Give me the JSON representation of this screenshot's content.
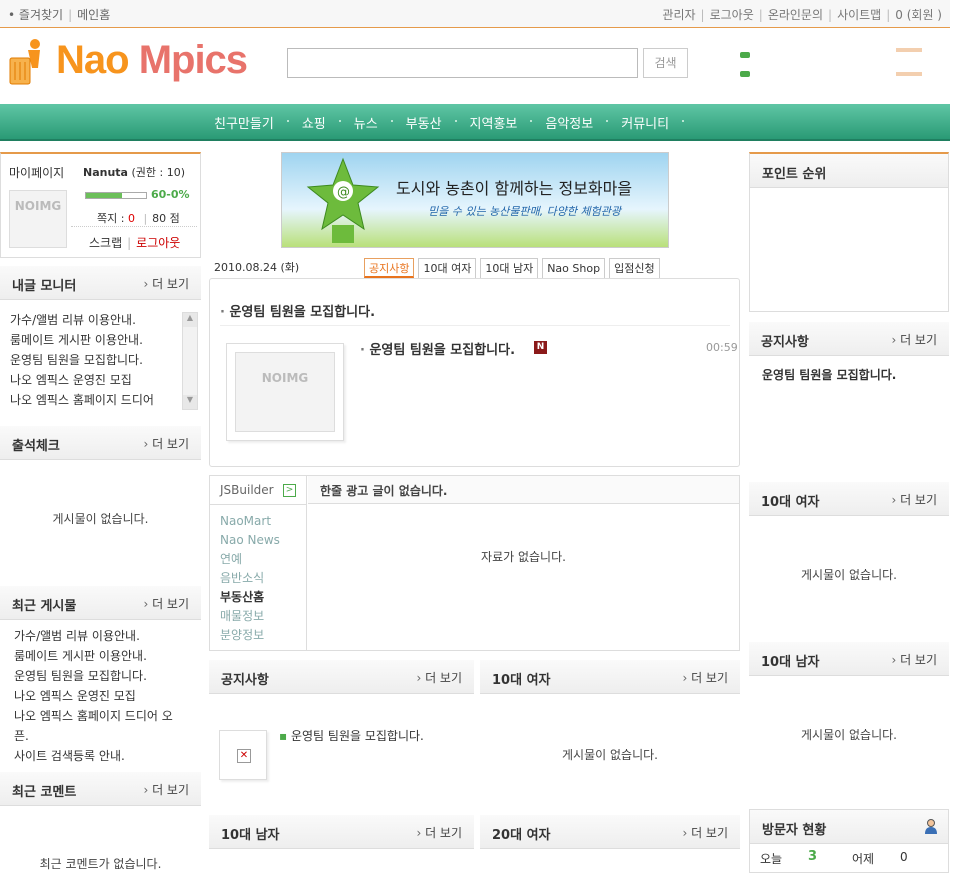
{
  "topbar": {
    "favorites": "즐겨찾기",
    "home": "메인홈",
    "admin": "관리자",
    "logout": "로그아웃",
    "inquiry": "온라인문의",
    "sitemap": "사이트맵",
    "members": "0 (회원 )"
  },
  "logo": {
    "part1": "Nao ",
    "part2": "Mpics"
  },
  "search": {
    "placeholder": "",
    "button": "검색"
  },
  "nav": [
    "친구만들기",
    "쇼핑",
    "뉴스",
    "부동산",
    "지역홍보",
    "음악정보",
    "커뮤니티"
  ],
  "mypage": {
    "title": "마이페이지",
    "user": "Nanuta",
    "level": "(권한 : 10)",
    "progress_label": "60-0%",
    "progress": 0.6,
    "note_label": "쪽지 :",
    "note_count": "0",
    "points": "80 점",
    "scrap": "스크랩",
    "logout": "로그아웃",
    "noimg": "NOIMG"
  },
  "left": {
    "monitor": {
      "title": "내글 모니터",
      "more": "더 보기",
      "items": [
        "가수/앨범 리뷰 이용안내.",
        "룸메이트 게시판 이용안내.",
        "운영팀 팀원을 모집합니다.",
        "나오 엠픽스 운영진 모집",
        "나오 엠픽스 홈페이지 드디어"
      ]
    },
    "attendance": {
      "title": "출석체크",
      "more": "더 보기",
      "empty": "게시물이 없습니다."
    },
    "recent": {
      "title": "최근 게시물",
      "more": "더 보기",
      "items": [
        "가수/앨범 리뷰 이용안내.",
        "룸메이트 게시판 이용안내.",
        "운영팀 팀원을 모집합니다.",
        "나오 엠픽스 운영진 모집",
        "나오 엠픽스 홈페이지 드디어 오",
        "픈.",
        "사이트 검색등록 안내."
      ]
    },
    "comments": {
      "title": "최근 코멘트",
      "more": "더 보기",
      "empty": "최근 코멘트가 없습니다."
    }
  },
  "banner": {
    "line1": "도시와 농촌이 함께하는 정보화마을",
    "line2": "믿을 수 있는 농산물판매, 다양한 체험관광"
  },
  "center": {
    "date": "2010.08.24 (화)",
    "tabs": [
      "공지사항",
      "10대 여자",
      "10대 남자",
      "Nao Shop",
      "입점신청"
    ],
    "headline": "운영팀 팀원을 모집합니다.",
    "post_title": "운영팀 팀원을 모집합니다.",
    "post_new": "N",
    "post_time": "00:59",
    "noimg": "NOIMG",
    "jsbuilder": {
      "label": "JSBuilder",
      "ad_title": "한줄 광고 글이 없습니다.",
      "empty": "자료가 없습니다.",
      "links": [
        "NaoMart",
        "Nao News",
        "연예",
        "음반소식",
        "부동산홈",
        "매물정보",
        "분양정보"
      ]
    },
    "notice": {
      "title": "공지사항",
      "more": "더 보기",
      "item": "운영팀 팀원을 모집합니다."
    },
    "teen_female": {
      "title": "10대 여자",
      "more": "더 보기",
      "empty": "게시물이 없습니다."
    },
    "teen_male": {
      "title": "10대 남자",
      "more": "더 보기"
    },
    "twenties_female": {
      "title": "20대 여자",
      "more": "더 보기"
    }
  },
  "right": {
    "points": {
      "title": "포인트 순위"
    },
    "notice": {
      "title": "공지사항",
      "more": "더 보기",
      "item": "운영팀 팀원을 모집합니다."
    },
    "teen_female": {
      "title": "10대 여자",
      "more": "더 보기",
      "empty": "게시물이 없습니다."
    },
    "teen_male": {
      "title": "10대 남자",
      "more": "더 보기",
      "empty": "게시물이 없습니다."
    },
    "visitors": {
      "title": "방문자 현황",
      "today_label": "오늘",
      "today": "3",
      "yesterday_label": "어제",
      "yesterday": "0"
    }
  },
  "colors": {
    "accent": "#f7941d",
    "nav": "#2a9a75",
    "progress": "#4caa4a"
  }
}
